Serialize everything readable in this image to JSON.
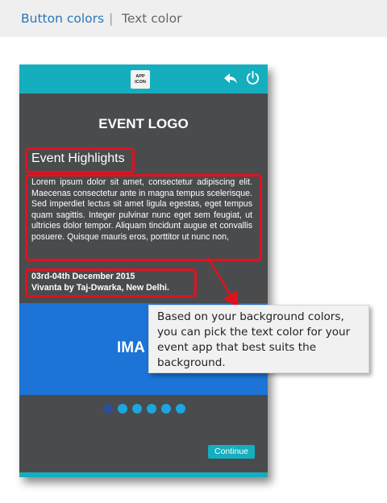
{
  "tabs": {
    "active": "Button colors",
    "separator": "|",
    "inactive": "Text color"
  },
  "phone": {
    "app_icon_line1": "APP",
    "app_icon_line2": "ICON",
    "event_logo": "EVENT LOGO",
    "highlights_title": "Event Highlights",
    "description": "Lorem ipsum dolor sit amet, consectetur adipiscing elit. Maecenas consectetur ante in magna tempus scelerisque. Sed imperdiet lectus sit amet ligula egestas, eget tempus quam sagittis. Integer pulvinar nunc eget sem feugiat, ut ultricies dolor tempor. Aliquam tincidunt augue et convallis posuere. Quisque mauris eros, porttitor ut nunc non,",
    "date": "03rd-04th December 2015",
    "venue": "Vivanta by Taj-Dwarka, New Delhi.",
    "image_label": "IMA",
    "carousel": {
      "total": 6,
      "active_index": 0
    },
    "continue_label": "Continue"
  },
  "callout": {
    "text": "Based on your background colors, you can pick the text color for your event app that best suits the background."
  },
  "colors": {
    "header_teal": "#15aebe",
    "phone_bg": "#4a4b4d",
    "image_blue": "#1b74d6",
    "highlight_red": "#e2111f",
    "link_blue": "#2a77b8"
  },
  "icons": {
    "back": "back-arrow-icon",
    "power": "power-icon"
  }
}
